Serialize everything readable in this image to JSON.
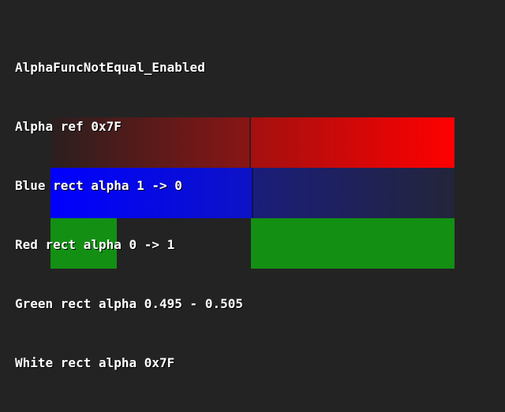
{
  "test": {
    "name": "AlphaFuncNotEqual_Enabled"
  },
  "info_lines": [
    "AlphaFuncNotEqual_Enabled",
    "Alpha ref 0x7F",
    "Blue rect alpha 1 -> 0",
    "Red rect alpha 0 -> 1",
    "Green rect alpha 0.495 - 0.505",
    "White rect alpha 0x7F"
  ],
  "colors": {
    "background": "#232323",
    "red": "#ff0000",
    "blue": "#0000ff",
    "green": "#139013",
    "text": "#ffffff"
  }
}
